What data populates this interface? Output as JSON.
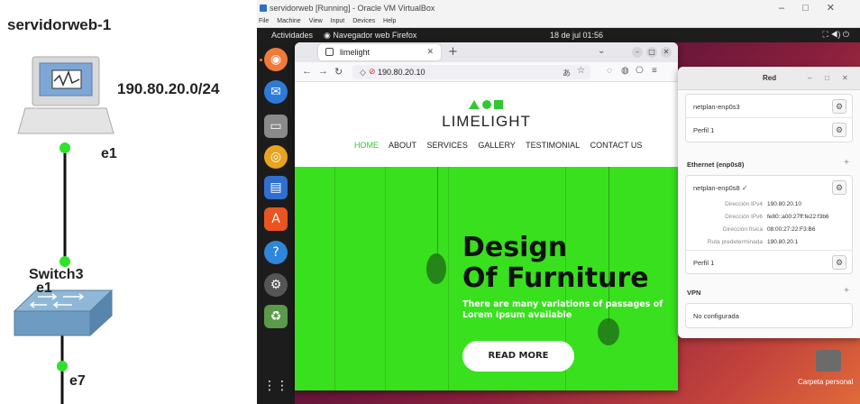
{
  "topology": {
    "server_title": "servidorweb-1",
    "subnet": "190.80.20.0/24",
    "server_port": "e1",
    "switch_name": "Switch3",
    "switch_port_top": "e1",
    "switch_port_bottom": "e7"
  },
  "vm": {
    "window_title": "servidorweb [Running] - Oracle VM VirtualBox",
    "menu": [
      "File",
      "Machine",
      "View",
      "Input",
      "Devices",
      "Help"
    ],
    "gnome": {
      "activities": "Actividades",
      "app": "Navegador web Firefox",
      "clock": "18 de jul  01:56"
    }
  },
  "firefox": {
    "tab_title": "limelight",
    "url": "190.80.20.10"
  },
  "site": {
    "logo": "LIMELIGHT",
    "nav": [
      "HOME",
      "ABOUT",
      "SERVICES",
      "GALLERY",
      "TESTIMONIAL",
      "CONTACT US"
    ],
    "hero_title_1": "Design",
    "hero_title_2": "Of Furniture",
    "hero_sub": "There are many variations of passages of Lorem Ipsum available",
    "cta": "READ MORE",
    "accent": "#39e01e"
  },
  "network": {
    "window_title": "Red",
    "conn1_name": "netplan-enp0s3",
    "conn1_profile": "Perfil 1",
    "ethernet_title": "Ethernet (enp0s8)",
    "conn2_name": "netplan-enp0s8",
    "details": [
      {
        "key": "Dirección IPv4",
        "value": "190.80.20.10"
      },
      {
        "key": "Dirección IPv6",
        "value": "fe80::a00:27ff:fe22:f3b6"
      },
      {
        "key": "Dirección física",
        "value": "08:00:27:22:F3:B6"
      },
      {
        "key": "Ruta predeterminada",
        "value": "190.80.20.1"
      }
    ],
    "conn2_profile": "Perfil 1",
    "vpn_title": "VPN",
    "vpn_status": "No configurada"
  },
  "desktop": {
    "folder_label": "Carpeta personal"
  }
}
